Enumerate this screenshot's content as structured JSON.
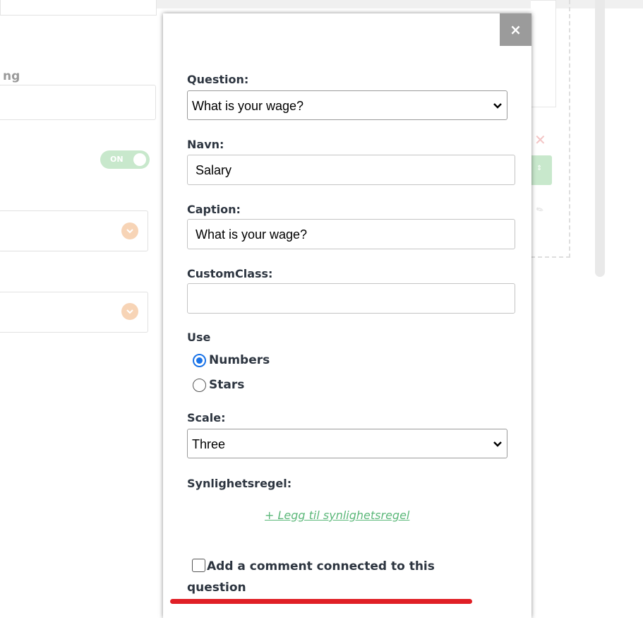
{
  "background": {
    "field_label_fragment": "ng",
    "toggle_label": "ON",
    "colors": {
      "toggle_on": "#c8e8cc",
      "chevron_badge": "#f7d4b6",
      "delete_x": "#f3c4c4"
    }
  },
  "modal": {
    "close_label": "×",
    "question": {
      "label": "Question:",
      "selected": "What is your wage?"
    },
    "name": {
      "label": "Navn:",
      "value": "Salary"
    },
    "caption": {
      "label": "Caption:",
      "value": "What is your wage?"
    },
    "custom_class": {
      "label": "CustomClass:",
      "value": ""
    },
    "use": {
      "label": "Use",
      "options": [
        {
          "label": "Numbers",
          "checked": true
        },
        {
          "label": "Stars",
          "checked": false
        }
      ]
    },
    "scale": {
      "label": "Scale:",
      "selected": "Three"
    },
    "visibility": {
      "label": "Synlighetsregel:",
      "add_link": "+ Legg til synlighetsregel"
    },
    "comment_checkbox": {
      "label": "Add a comment connected to this question",
      "checked": false
    }
  },
  "annotation": {
    "underline_color": "#e01f26"
  }
}
